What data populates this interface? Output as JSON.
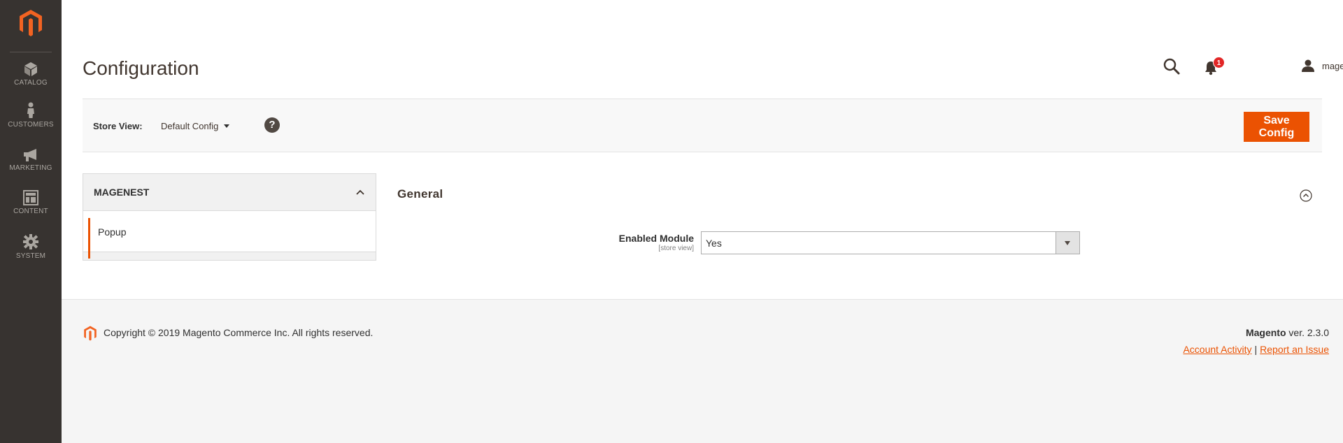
{
  "sidebar": {
    "logo": "magento-logo-icon",
    "items": [
      {
        "label": "CATALOG",
        "icon": "cube-icon"
      },
      {
        "label": "CUSTOMERS",
        "icon": "person-icon"
      },
      {
        "label": "MARKETING",
        "icon": "megaphone-icon"
      },
      {
        "label": "CONTENT",
        "icon": "layout-icon"
      },
      {
        "label": "SYSTEM",
        "icon": "gear-icon"
      }
    ]
  },
  "header": {
    "title": "Configuration",
    "notifications_count": "1",
    "user_name": "magenest"
  },
  "store_bar": {
    "label": "Store View:",
    "selected": "Default Config",
    "help_symbol": "?",
    "save_label": "Save Config"
  },
  "tabs": {
    "group": "MAGENEST",
    "items": [
      {
        "label": "Popup",
        "active": true
      }
    ]
  },
  "section": {
    "title": "General",
    "fields": [
      {
        "label": "Enabled Module",
        "scope": "[store view]",
        "value": "Yes"
      }
    ]
  },
  "footer": {
    "copyright": "Copyright © 2019 Magento Commerce Inc. All rights reserved.",
    "brand": "Magento",
    "version": " ver. 2.3.0",
    "link_activity": "Account Activity",
    "separator": "|",
    "link_issue": "Report an Issue"
  },
  "colors": {
    "accent": "#eb5202",
    "sidebar_bg": "#373330",
    "badge": "#e22626"
  }
}
